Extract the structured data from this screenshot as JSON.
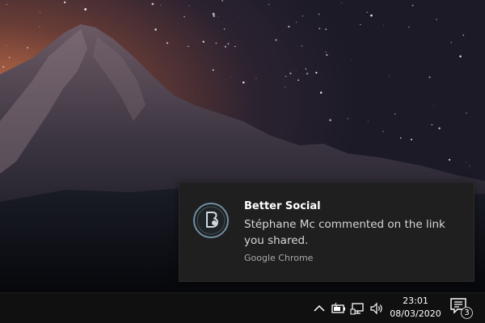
{
  "notification": {
    "app_name": "Better Social",
    "message": "Stéphane Mc commented on the link you shared.",
    "source": "Google Chrome",
    "icon": "better-social-logo-icon"
  },
  "taskbar": {
    "clock": {
      "time": "23:01",
      "date": "08/03/2020"
    },
    "tray_icons": [
      "chevron-up-icon",
      "battery-icon",
      "network-icon",
      "volume-icon"
    ],
    "action_center": {
      "icon": "notification-icon",
      "count": "3"
    }
  },
  "colors": {
    "toast_background": "#1f1f1f",
    "taskbar_background": "#101010",
    "icon_accent": "#6f8fa3"
  }
}
